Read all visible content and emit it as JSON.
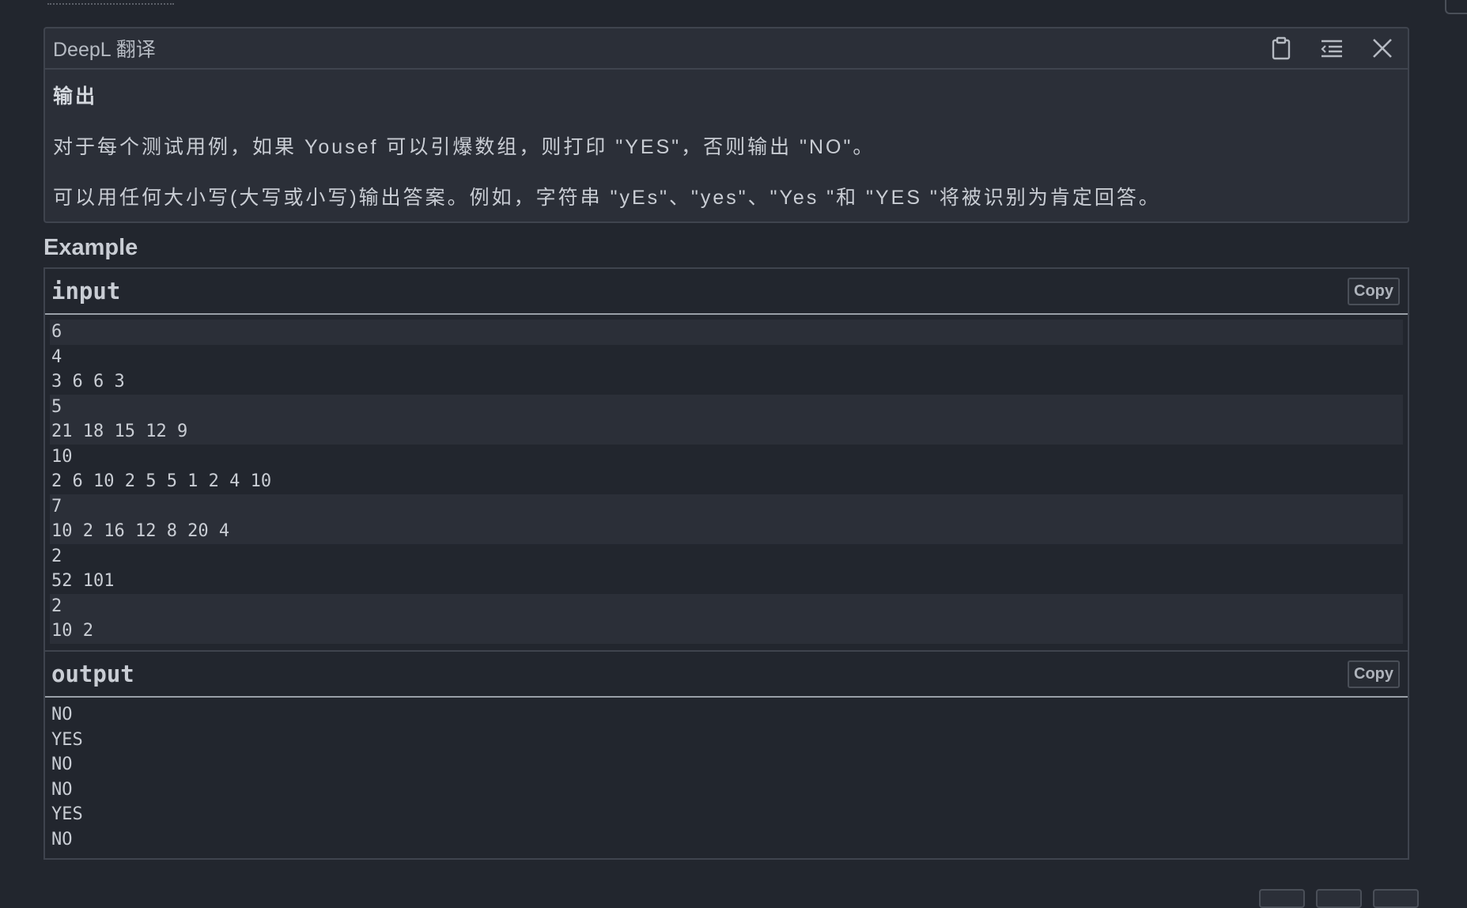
{
  "deepl": {
    "title": "DeepL 翻译",
    "heading": "输出",
    "paragraphs": [
      "对于每个测试用例，如果 Yousef 可以引爆数组，则打印 \"YES\"，否则输出 \"NO\"。",
      "可以用任何大小写(大写或小写)输出答案。例如，字符串 \"yEs\"、\"yes\"、\"Yes \"和 \"YES \"将被识别为肯定回答。"
    ],
    "icons": [
      "clipboard-icon",
      "indent-icon",
      "close-icon"
    ]
  },
  "example": {
    "title": "Example",
    "input": {
      "label": "input",
      "copy_label": "Copy",
      "lines": [
        "6",
        "4",
        "3 6 6 3",
        "5",
        "21 18 15 12 9",
        "10",
        "2 6 10 2 5 5 1 2 4 10",
        "7",
        "10 2 16 12 8 20 4",
        "2",
        "52 101",
        "2",
        "10 2"
      ]
    },
    "output": {
      "label": "output",
      "copy_label": "Copy",
      "lines": [
        "NO",
        "YES",
        "NO",
        "NO",
        "YES",
        "NO"
      ]
    }
  }
}
